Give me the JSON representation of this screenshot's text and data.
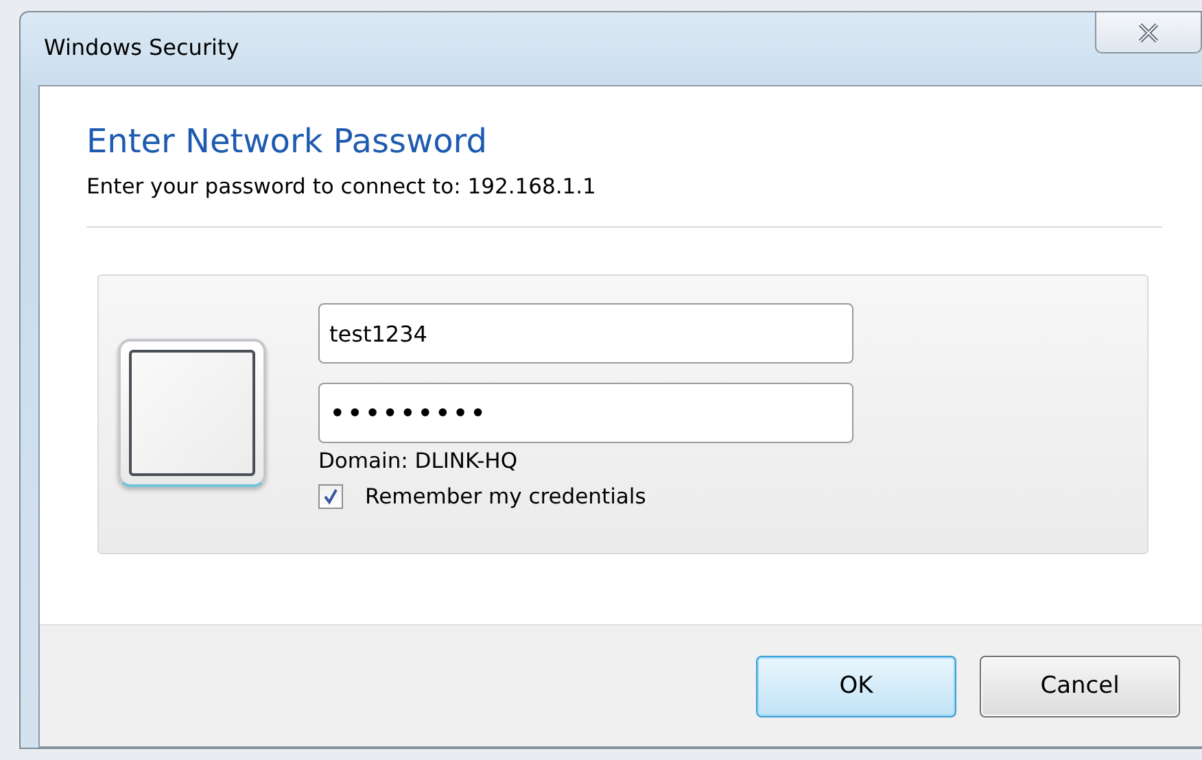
{
  "window": {
    "title": "Windows Security"
  },
  "heading": "Enter Network Password",
  "subtitle": "Enter your password to connect to: 192.168.1.1",
  "credentials": {
    "username": "test1234",
    "password": "•••••••••",
    "domain": "Domain: DLINK-HQ",
    "remember": {
      "label": "Remember my credentials",
      "checked": true
    }
  },
  "buttons": [
    {
      "label": "OK",
      "default": true
    },
    {
      "label": "Cancel",
      "default": false
    }
  ]
}
